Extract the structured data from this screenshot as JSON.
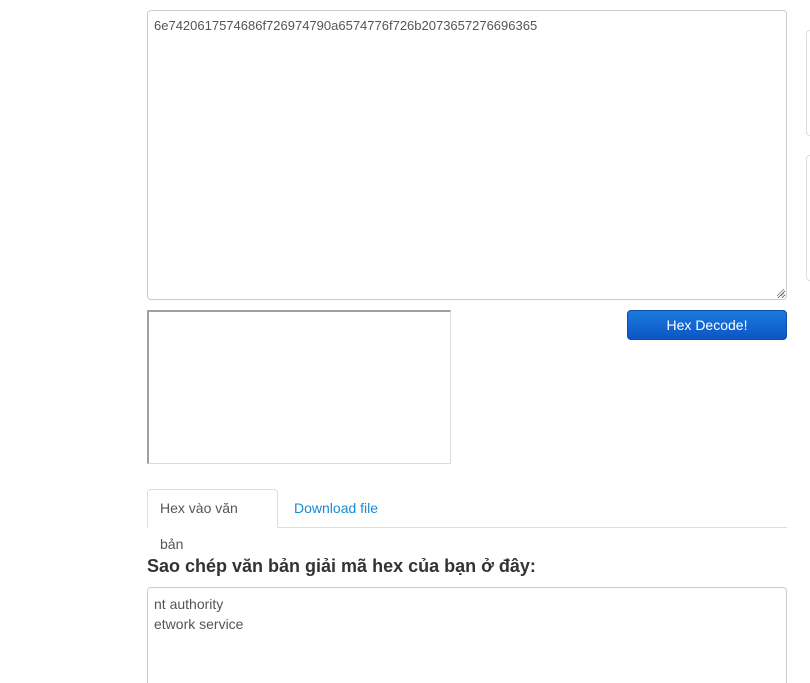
{
  "hex_input": {
    "value": "6e7420617574686f726974790a6574776f726b2073657276696365"
  },
  "decode_button": {
    "label": "Hex Decode!"
  },
  "tabs": [
    {
      "label": "Hex vào văn bản",
      "active": true
    },
    {
      "label": "Download file",
      "active": false
    }
  ],
  "output": {
    "heading": "Sao chép văn bản giải mã hex của bạn ở đây:",
    "lines": [
      "nt authority",
      "etwork service"
    ]
  },
  "colors": {
    "button_bg": "#0b56c4",
    "link": "#1a8ad4",
    "border": "#cccccc"
  }
}
